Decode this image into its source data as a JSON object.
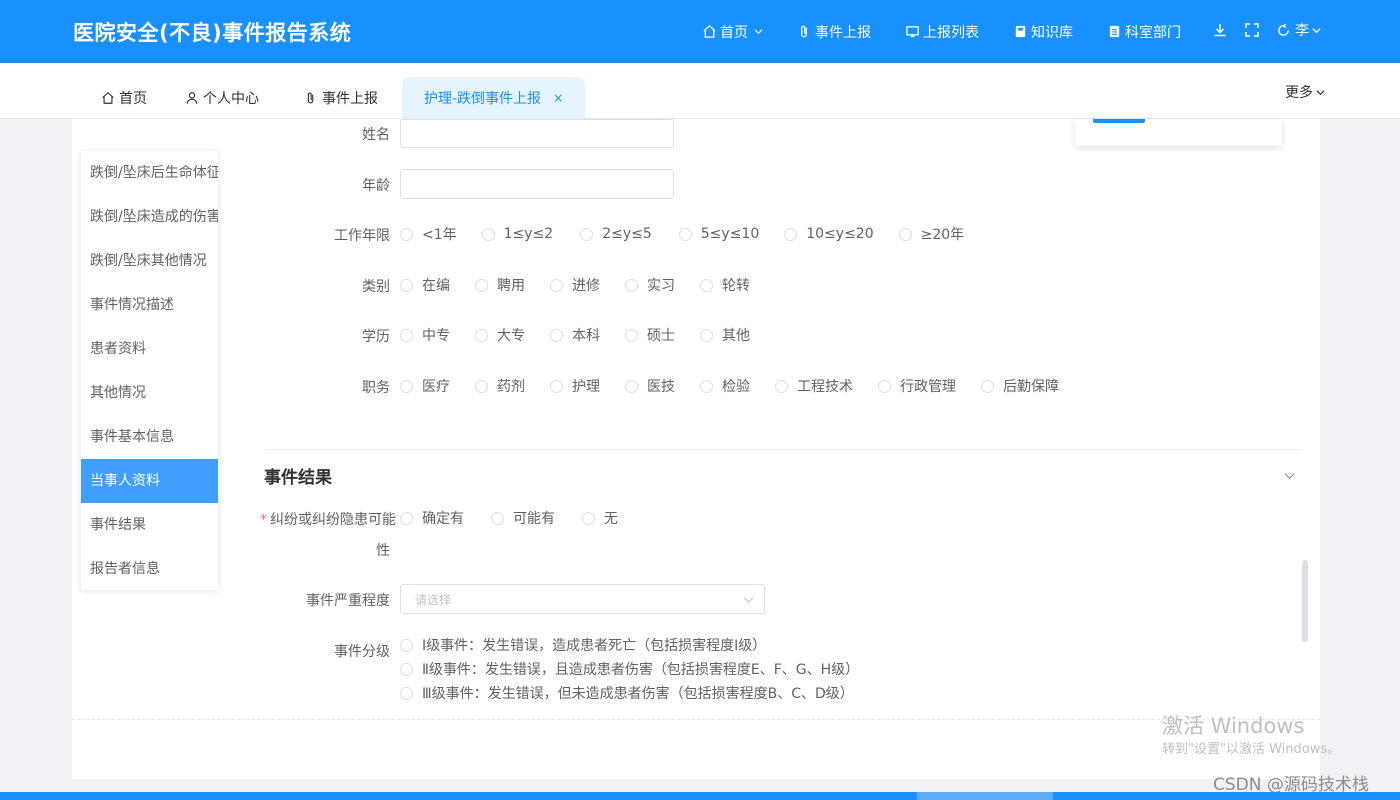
{
  "header": {
    "title": "医院安全(不良)事件报告系统",
    "nav": [
      {
        "label": "首页",
        "icon": "home-icon",
        "has_dropdown": true
      },
      {
        "label": "事件上报",
        "icon": "paperclip-icon",
        "has_dropdown": false
      },
      {
        "label": "上报列表",
        "icon": "monitor-icon",
        "has_dropdown": false
      },
      {
        "label": "知识库",
        "icon": "book-icon",
        "has_dropdown": false
      },
      {
        "label": "科室部门",
        "icon": "document-icon",
        "has_dropdown": false
      }
    ],
    "tools": [
      "download-icon",
      "fullscreen-icon"
    ],
    "user": {
      "name": "李",
      "icon": "refresh-icon"
    }
  },
  "tabs": {
    "items": [
      {
        "label": "首页",
        "icon": "home-icon"
      },
      {
        "label": "个人中心",
        "icon": "user-icon"
      },
      {
        "label": "事件上报",
        "icon": "paperclip-icon"
      },
      {
        "label": "护理-跌倒事件上报",
        "close": "×"
      }
    ],
    "more_label": "更多"
  },
  "anchor_nav": {
    "items": [
      "跌倒/坠床后生命体征",
      "跌倒/坠床造成的伤害",
      "跌倒/坠床其他情况",
      "事件情况描述",
      "患者资料",
      "其他情况",
      "事件基本信息",
      "当事人资料",
      "事件结果",
      "报告者信息"
    ],
    "active_index": 7
  },
  "form": {
    "name_label": "姓名",
    "name_value": "",
    "age_label": "年龄",
    "age_value": "",
    "work_years": {
      "label": "工作年限",
      "options": [
        "<1年",
        "1≤y≤2",
        "2≤y≤5",
        "5≤y≤10",
        "10≤y≤20",
        "≥20年"
      ]
    },
    "category": {
      "label": "类别",
      "options": [
        "在编",
        "聘用",
        "进修",
        "实习",
        "轮转"
      ]
    },
    "education": {
      "label": "学历",
      "options": [
        "中专",
        "大专",
        "本科",
        "硕士",
        "其他"
      ]
    },
    "position": {
      "label": "职务",
      "options": [
        "医疗",
        "药剂",
        "护理",
        "医技",
        "检验",
        "工程技术",
        "行政管理",
        "后勤保障"
      ]
    }
  },
  "result_section": {
    "title": "事件结果",
    "dispute": {
      "label_line1": "纠纷或纠纷隐患可能",
      "label_line2": "性",
      "required_mark": "*",
      "options": [
        "确定有",
        "可能有",
        "无"
      ]
    },
    "severity": {
      "label": "事件严重程度",
      "placeholder": "请选择"
    },
    "grade": {
      "label": "事件分级",
      "options": [
        "Ⅰ级事件：发生错误，造成患者死亡（包括损害程度Ⅰ级）",
        "Ⅱ级事件：发生错误，且造成患者伤害（包括损害程度E、F、G、H级）",
        "Ⅲ级事件：发生错误，但未造成患者伤害（包括损害程度B、C、D级）"
      ]
    }
  },
  "watermark": {
    "line1": "激活 Windows",
    "line2": "转到\"设置\"以激活 Windows。",
    "csdn": "CSDN @源码技术栈"
  },
  "colors": {
    "primary": "#1890ff",
    "active_anchor": "#409eff",
    "required": "#f56c6c"
  }
}
